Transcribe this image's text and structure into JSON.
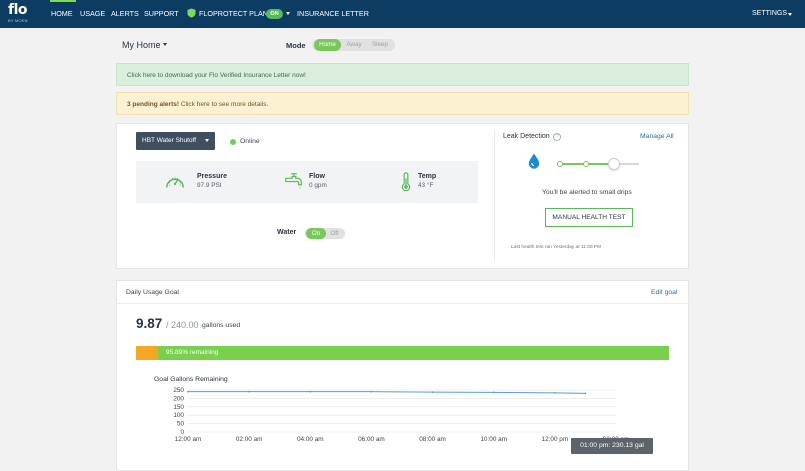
{
  "brand": {
    "logo": "flo",
    "sub": "BY MOEN"
  },
  "nav": {
    "home": "HOME",
    "usage": "USAGE",
    "alerts": "ALERTS",
    "support": "SUPPORT",
    "floprotect": "FLOPROTECT PLAN",
    "floprotect_status": "ON",
    "insurance": "INSURANCE LETTER",
    "settings": "SETTINGS"
  },
  "location": {
    "name": "My Home"
  },
  "mode": {
    "label": "Mode",
    "options": [
      "Home",
      "Away",
      "Sleep"
    ],
    "selected": "Home"
  },
  "banners": {
    "insurance": "Click here to download your Flo Verified Insurance Letter now!",
    "alerts_bold": "3 pending alerts!",
    "alerts_rest": " Click here to see more details."
  },
  "device": {
    "name": "HBT Water Shutoff",
    "status": "Online",
    "pressure": {
      "title": "Pressure",
      "value": "97.9 PSI"
    },
    "flow": {
      "title": "Flow",
      "value": "0 gpm"
    },
    "temp": {
      "title": "Temp",
      "value": "43 °F"
    },
    "water": {
      "label": "Water",
      "on": "On",
      "off": "Off",
      "selected": "On"
    }
  },
  "leak": {
    "title": "Leak Detection",
    "help": "?",
    "manage": "Manage All",
    "sensitivity_level": 0.7,
    "alert_text": "You'll be alerted to small drips",
    "health_button": "MANUAL HEALTH TEST",
    "last_run": "Last health test ran Yesterday at 11:00 PM"
  },
  "usage": {
    "title": "Daily Usage Goal",
    "edit": "Edit goal",
    "used": "9.87",
    "goal": "/ 240.00",
    "unit": "gallons used",
    "remaining_fraction": 0.9589,
    "remaining_label": "95.89% remaining",
    "tooltip": "01:00 pm: 230.13 gal"
  },
  "colors": {
    "nav_bg": "#0c3c61",
    "accent_green": "#78c85a",
    "used_orange": "#f5a623",
    "link_blue": "#1f6fb2",
    "line_blue": "#5b9bd5"
  },
  "chart_data": {
    "type": "line",
    "title": "Goal Gallons Remaining",
    "xlabel": "",
    "ylabel": "",
    "x": [
      "12:00 am",
      "02:00 am",
      "04:00 am",
      "06:00 am",
      "08:00 am",
      "10:00 am",
      "12:00 pm",
      "01:00 pm"
    ],
    "x_ticks": [
      "12:00 am",
      "02:00 am",
      "04:00 am",
      "06:00 am",
      "08:00 am",
      "10:00 am",
      "12:00 pm",
      "02:00 pm"
    ],
    "y_ticks": [
      0,
      50,
      100,
      150,
      200,
      250
    ],
    "ylim": [
      0,
      250
    ],
    "series": [
      {
        "values": [
          240,
          240,
          240,
          240,
          237,
          236,
          233,
          230.13
        ]
      }
    ],
    "grid": true
  }
}
